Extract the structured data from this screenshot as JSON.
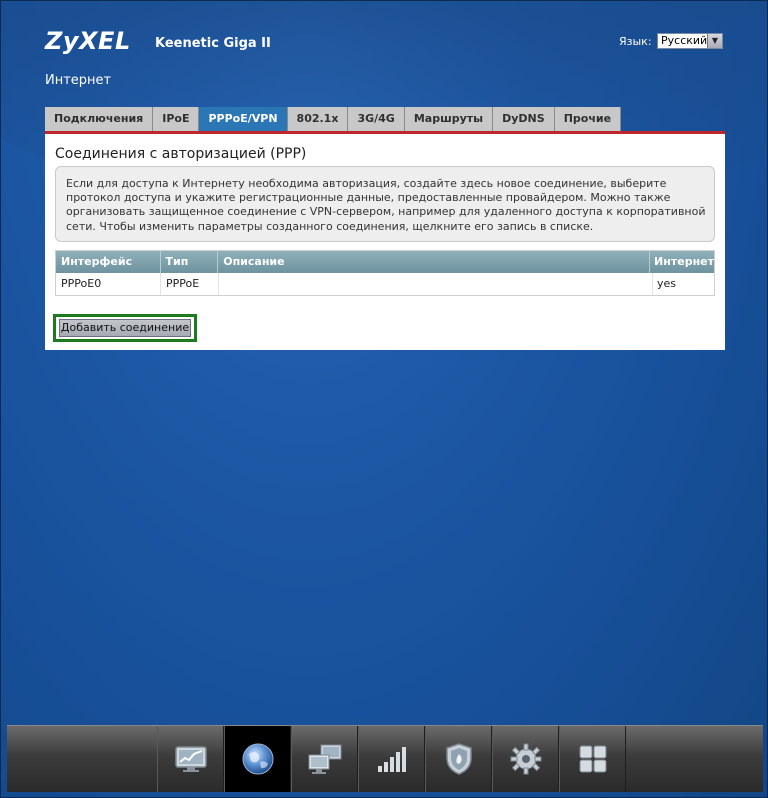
{
  "header": {
    "logo": "ZyXEL",
    "model": "Keenetic Giga II",
    "language_label": "Язык:",
    "language_value": "Русский"
  },
  "page_title": "Интернет",
  "tabs": [
    {
      "label": "Подключения",
      "active": false
    },
    {
      "label": "IPoE",
      "active": false
    },
    {
      "label": "PPPoE/VPN",
      "active": true
    },
    {
      "label": "802.1x",
      "active": false
    },
    {
      "label": "3G/4G",
      "active": false
    },
    {
      "label": "Маршруты",
      "active": false
    },
    {
      "label": "DyDNS",
      "active": false
    },
    {
      "label": "Прочие",
      "active": false
    }
  ],
  "panel": {
    "title": "Соединения с авторизацией (PPP)",
    "info": "Если для доступа к Интернету необходима авторизация, создайте здесь новое соединение, выберите протокол доступа и укажите регистрационные данные, предоставленные провайдером. Можно также организовать защищенное соединение с VPN-сервером, например для удаленного доступа к корпоративной сети. Чтобы изменить параметры созданного соединения, щелкните его запись в списке.",
    "table": {
      "headers": [
        "Интерфейс",
        "Тип",
        "Описание",
        "Интернет"
      ],
      "rows": [
        [
          "PPPoE0",
          "PPPoE",
          "",
          "yes"
        ]
      ]
    },
    "add_button": "Добавить соединение"
  },
  "dock": {
    "items": [
      {
        "icon": "monitor-chart-icon",
        "active": false
      },
      {
        "icon": "globe-icon",
        "active": true
      },
      {
        "icon": "network-computers-icon",
        "active": false
      },
      {
        "icon": "signal-bars-icon",
        "active": false
      },
      {
        "icon": "shield-icon",
        "active": false
      },
      {
        "icon": "gear-icon",
        "active": false
      },
      {
        "icon": "apps-grid-icon",
        "active": false
      }
    ]
  },
  "colors": {
    "active_tab": "#2b77b6",
    "tab_underline": "#c0272d",
    "button_highlight": "#1e7a1e",
    "table_header": "#7fa3ae"
  }
}
